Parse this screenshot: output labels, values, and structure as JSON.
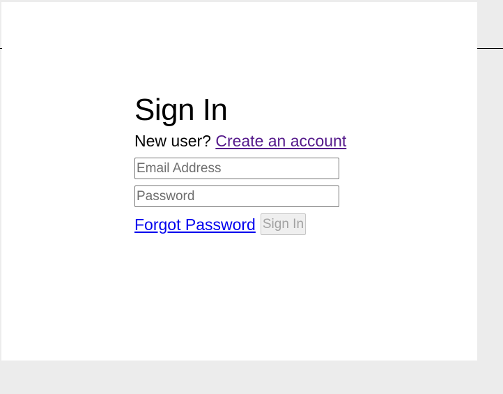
{
  "signin": {
    "title": "Sign In",
    "new_user_text": "New user?",
    "create_account_link": "Create an account",
    "email_placeholder": "Email Address",
    "email_value": "",
    "password_placeholder": "Password",
    "password_value": "",
    "forgot_password_link": "Forgot Password",
    "submit_label": "Sign In",
    "submit_disabled": true
  },
  "colors": {
    "page_background": "#ececec",
    "panel_background": "#ffffff",
    "visited_link": "#551a8b",
    "link": "#0000ee",
    "disabled_text": "#a2a2a2"
  }
}
